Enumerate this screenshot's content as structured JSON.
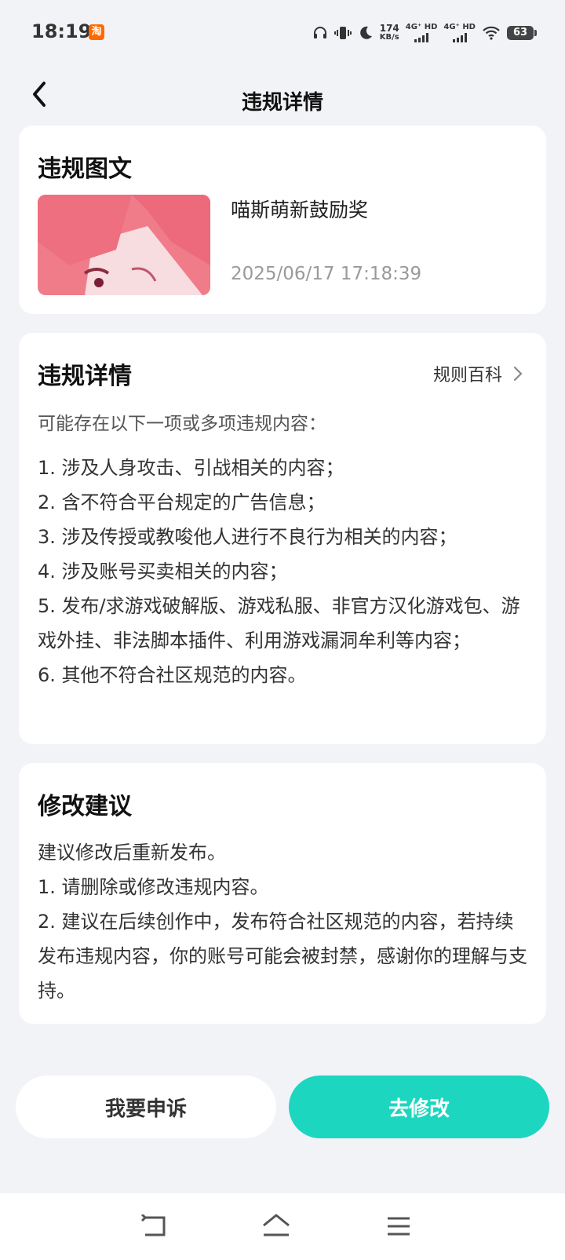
{
  "status_bar": {
    "time": "18:19",
    "app_icon": "taobao-icon",
    "net_speed_value": "174",
    "net_speed_unit": "KB/s",
    "signal1": "4G⁺ HD",
    "signal2": "4G⁺ HD",
    "battery": "63"
  },
  "header": {
    "title": "违规详情"
  },
  "violation_post": {
    "section_title": "违规图文",
    "post_title": "喵斯萌新鼓励奖",
    "post_time": "2025/06/17 17:18:39"
  },
  "violation_details": {
    "section_title": "违规详情",
    "rules_link": "规则百科",
    "intro": "可能存在以下一项或多项违规内容：",
    "items": [
      "1. 涉及人身攻击、引战相关的内容；",
      "2. 含不符合平台规定的广告信息；",
      "3. 涉及传授或教唆他人进行不良行为相关的内容；",
      "4. 涉及账号买卖相关的内容；",
      "5. 发布/求游戏破解版、游戏私服、非官方汉化游戏包、游戏外挂、非法脚本插件、利用游戏漏洞牟利等内容；",
      "6. 其他不符合社区规范的内容。"
    ]
  },
  "suggestions": {
    "section_title": "修改建议",
    "lines": [
      "建议修改后重新发布。",
      "1. 请删除或修改违规内容。",
      "2. 建议在后续创作中，发布符合社区规范的内容，若持续发布违规内容，你的账号可能会被封禁，感谢你的理解与支持。"
    ]
  },
  "actions": {
    "appeal": "我要申诉",
    "modify": "去修改"
  },
  "colors": {
    "accent": "#1dd6bf",
    "background": "#f2f3f7"
  }
}
